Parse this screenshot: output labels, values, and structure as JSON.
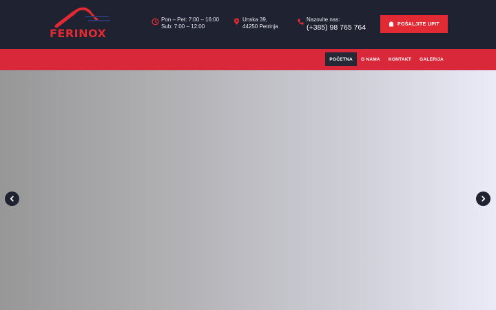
{
  "brand": {
    "name": "FERINOX",
    "color": "#e12a33"
  },
  "header": {
    "hours": {
      "icon": "clock-icon",
      "line1": "Pon – Pet: 7:00 – 16:00",
      "line2": "Sub: 7:00 – 12:00"
    },
    "address": {
      "icon": "map-pin-icon",
      "line1": "Unska 39,",
      "line2": "44250 Petrinja"
    },
    "phone": {
      "icon": "phone-icon",
      "label": "Nazovite nas:",
      "number": "(+385) 98 765 764"
    },
    "cta": {
      "icon": "inquiry-icon",
      "label": "POŠALJITE UPIT"
    }
  },
  "nav": {
    "items": [
      {
        "label": "POČETNA",
        "active": true
      },
      {
        "label": "O NAMA"
      },
      {
        "label": "KONTAKT"
      },
      {
        "label": "GALERIJA"
      }
    ]
  },
  "slider": {
    "prev_icon": "chevron-left-icon",
    "next_icon": "chevron-right-icon"
  },
  "colors": {
    "header_bg": "#1f2230",
    "accent": "#e12a33",
    "nav_bg": "#d8283a"
  }
}
